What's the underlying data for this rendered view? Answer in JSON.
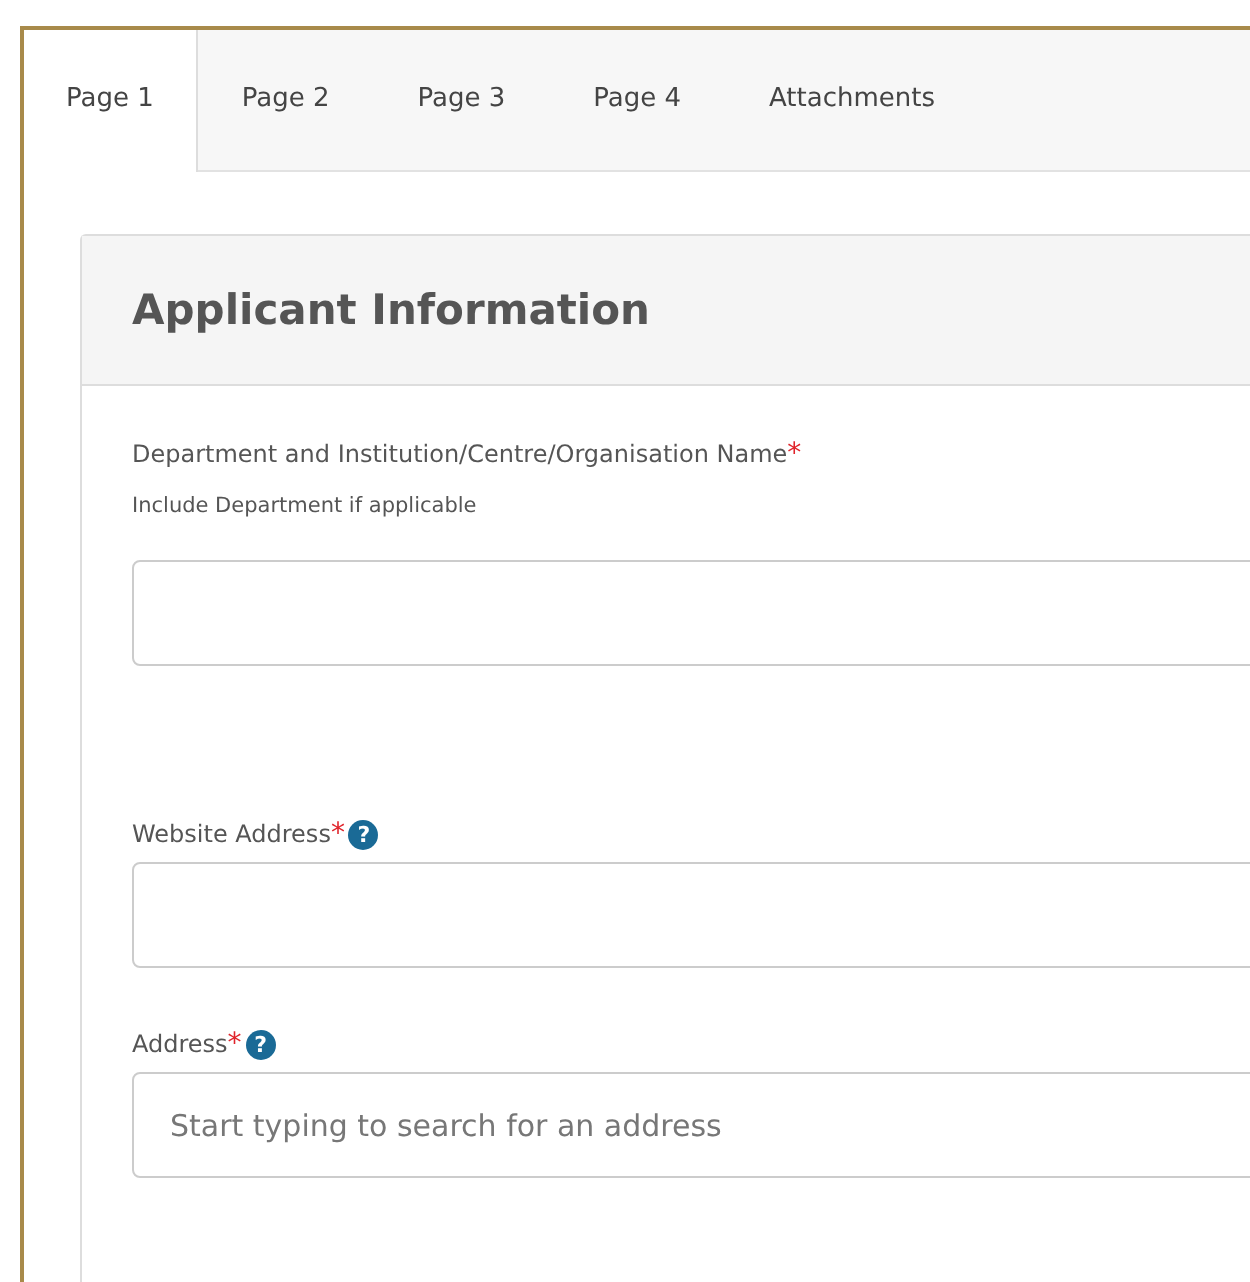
{
  "tabs": [
    {
      "label": "Page 1",
      "selected": true
    },
    {
      "label": "Page 2",
      "selected": false
    },
    {
      "label": "Page 3",
      "selected": false
    },
    {
      "label": "Page 4",
      "selected": false
    },
    {
      "label": "Attachments",
      "selected": false
    }
  ],
  "panel": {
    "title": "Applicant Information",
    "fields": [
      {
        "label": "Department and Institution/Centre/Organisation Name",
        "required_mark": "*",
        "hint": "Include Department if applicable"
      },
      {
        "label": "Website Address",
        "required_mark": "*",
        "help": "?"
      },
      {
        "label": "Address",
        "required_mark": "*",
        "help": "?",
        "placeholder": "Start typing to search for an address"
      }
    ]
  }
}
